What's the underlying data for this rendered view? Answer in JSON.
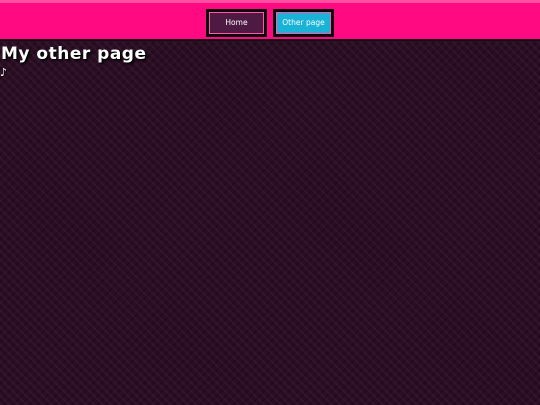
{
  "nav": {
    "home_label": "Home",
    "other_label": "Other page"
  },
  "main": {
    "title": "My other page"
  },
  "colors": {
    "topbar": "#ff0a80",
    "active_tab": "#19b3d8",
    "inactive_tab": "#4e1a44",
    "background": "#2b0d24"
  },
  "icons": {
    "fragment": "link-fragment-icon"
  }
}
